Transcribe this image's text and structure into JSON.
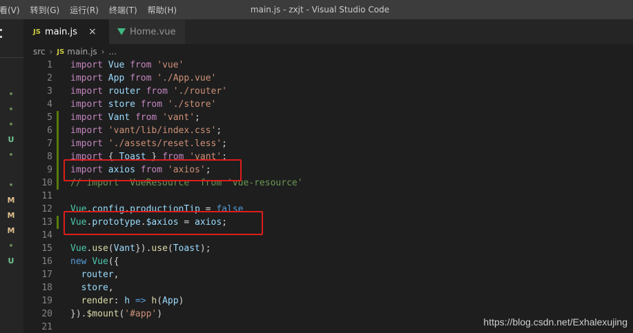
{
  "menu": [
    "看(V)",
    "转到(G)",
    "运行(R)",
    "终端(T)",
    "帮助(H)"
  ],
  "window_title": "main.js - zxjt - Visual Studio Code",
  "tabs": [
    {
      "label": "main.js",
      "icon": "js-file-icon",
      "active": true
    },
    {
      "label": "Home.vue",
      "icon": "vue-file-icon",
      "active": false
    }
  ],
  "breadcrumb": [
    "src",
    "main.js",
    "..."
  ],
  "activity_marks": [
    "•",
    "•",
    "•",
    "U",
    "•",
    "•",
    "M",
    "M",
    "M",
    "•",
    "U"
  ],
  "lines": [
    {
      "n": "1",
      "tokens": [
        [
          "kw2",
          "import"
        ],
        [
          "punc",
          " "
        ],
        [
          "var",
          "Vue"
        ],
        [
          "punc",
          " "
        ],
        [
          "kw2",
          "from"
        ],
        [
          "punc",
          " "
        ],
        [
          "str",
          "'vue'"
        ]
      ]
    },
    {
      "n": "2",
      "tokens": [
        [
          "kw2",
          "import"
        ],
        [
          "punc",
          " "
        ],
        [
          "var",
          "App"
        ],
        [
          "punc",
          " "
        ],
        [
          "kw2",
          "from"
        ],
        [
          "punc",
          " "
        ],
        [
          "str",
          "'./App.vue'"
        ]
      ]
    },
    {
      "n": "3",
      "tokens": [
        [
          "kw2",
          "import"
        ],
        [
          "punc",
          " "
        ],
        [
          "var",
          "router"
        ],
        [
          "punc",
          " "
        ],
        [
          "kw2",
          "from"
        ],
        [
          "punc",
          " "
        ],
        [
          "str",
          "'./router'"
        ]
      ]
    },
    {
      "n": "4",
      "tokens": [
        [
          "kw2",
          "import"
        ],
        [
          "punc",
          " "
        ],
        [
          "var",
          "store"
        ],
        [
          "punc",
          " "
        ],
        [
          "kw2",
          "from"
        ],
        [
          "punc",
          " "
        ],
        [
          "str",
          "'./store'"
        ]
      ]
    },
    {
      "n": "5",
      "tokens": [
        [
          "kw2",
          "import"
        ],
        [
          "punc",
          " "
        ],
        [
          "var",
          "Vant"
        ],
        [
          "punc",
          " "
        ],
        [
          "kw2",
          "from"
        ],
        [
          "punc",
          " "
        ],
        [
          "str",
          "'vant'"
        ],
        [
          "punc",
          ";"
        ]
      ]
    },
    {
      "n": "6",
      "tokens": [
        [
          "kw2",
          "import"
        ],
        [
          "punc",
          " "
        ],
        [
          "str",
          "'vant/lib/index.css'"
        ],
        [
          "punc",
          ";"
        ]
      ]
    },
    {
      "n": "7",
      "tokens": [
        [
          "kw2",
          "import"
        ],
        [
          "punc",
          " "
        ],
        [
          "str",
          "'./assets/reset.less'"
        ],
        [
          "punc",
          ";"
        ]
      ]
    },
    {
      "n": "8",
      "tokens": [
        [
          "kw2",
          "import"
        ],
        [
          "punc",
          " { "
        ],
        [
          "var",
          "Toast"
        ],
        [
          "punc",
          " } "
        ],
        [
          "kw2",
          "from"
        ],
        [
          "punc",
          " "
        ],
        [
          "str",
          "'vant'"
        ],
        [
          "punc",
          ";"
        ]
      ]
    },
    {
      "n": "9",
      "tokens": [
        [
          "kw2",
          "import"
        ],
        [
          "punc",
          " "
        ],
        [
          "var",
          "axios"
        ],
        [
          "punc",
          " "
        ],
        [
          "kw2",
          "from"
        ],
        [
          "punc",
          " "
        ],
        [
          "str",
          "'axios'"
        ],
        [
          "punc",
          ";"
        ]
      ]
    },
    {
      "n": "10",
      "tokens": [
        [
          "cmt",
          "// import  VueResource  from 'vue-resource'"
        ]
      ]
    },
    {
      "n": "11",
      "tokens": []
    },
    {
      "n": "12",
      "tokens": [
        [
          "cls",
          "Vue"
        ],
        [
          "punc",
          "."
        ],
        [
          "var",
          "config"
        ],
        [
          "punc",
          "."
        ],
        [
          "var",
          "productionTip"
        ],
        [
          "punc",
          " = "
        ],
        [
          "kw",
          "false"
        ]
      ]
    },
    {
      "n": "13",
      "tokens": [
        [
          "cls",
          "Vue"
        ],
        [
          "punc",
          "."
        ],
        [
          "var",
          "prototype"
        ],
        [
          "punc",
          "."
        ],
        [
          "var",
          "$axios"
        ],
        [
          "punc",
          " = "
        ],
        [
          "var",
          "axios"
        ],
        [
          "punc",
          ";"
        ]
      ]
    },
    {
      "n": "14",
      "tokens": []
    },
    {
      "n": "15",
      "tokens": [
        [
          "cls",
          "Vue"
        ],
        [
          "punc",
          "."
        ],
        [
          "fn",
          "use"
        ],
        [
          "punc",
          "("
        ],
        [
          "var",
          "Vant"
        ],
        [
          "punc",
          "})."
        ],
        [
          "fn",
          "use"
        ],
        [
          "punc",
          "("
        ],
        [
          "var",
          "Toast"
        ],
        [
          "punc",
          ");"
        ]
      ]
    },
    {
      "n": "16",
      "tokens": [
        [
          "kw",
          "new"
        ],
        [
          "punc",
          " "
        ],
        [
          "cls",
          "Vue"
        ],
        [
          "punc",
          "({"
        ]
      ]
    },
    {
      "n": "17",
      "tokens": [
        [
          "punc",
          "  "
        ],
        [
          "var",
          "router"
        ],
        [
          "punc",
          ","
        ]
      ]
    },
    {
      "n": "18",
      "tokens": [
        [
          "punc",
          "  "
        ],
        [
          "var",
          "store"
        ],
        [
          "punc",
          ","
        ]
      ]
    },
    {
      "n": "19",
      "tokens": [
        [
          "punc",
          "  "
        ],
        [
          "fn",
          "render"
        ],
        [
          "punc",
          ": "
        ],
        [
          "var",
          "h"
        ],
        [
          "punc",
          " "
        ],
        [
          "kw",
          "=>"
        ],
        [
          "punc",
          " "
        ],
        [
          "fn",
          "h"
        ],
        [
          "punc",
          "("
        ],
        [
          "var",
          "App"
        ],
        [
          "punc",
          ")"
        ]
      ]
    },
    {
      "n": "20",
      "tokens": [
        [
          "punc",
          "})."
        ],
        [
          "fn",
          "$mount"
        ],
        [
          "punc",
          "("
        ],
        [
          "str",
          "'#app'"
        ],
        [
          "punc",
          ")"
        ]
      ]
    },
    {
      "n": "21",
      "tokens": []
    }
  ],
  "modified_lines": [
    "5",
    "6",
    "7",
    "8",
    "9",
    "10",
    "13"
  ],
  "colors": {
    "annotation": "#e01c1c",
    "editor_bg": "#1e1e1e"
  },
  "watermark": "https://blog.csdn.net/Exhalexujing"
}
